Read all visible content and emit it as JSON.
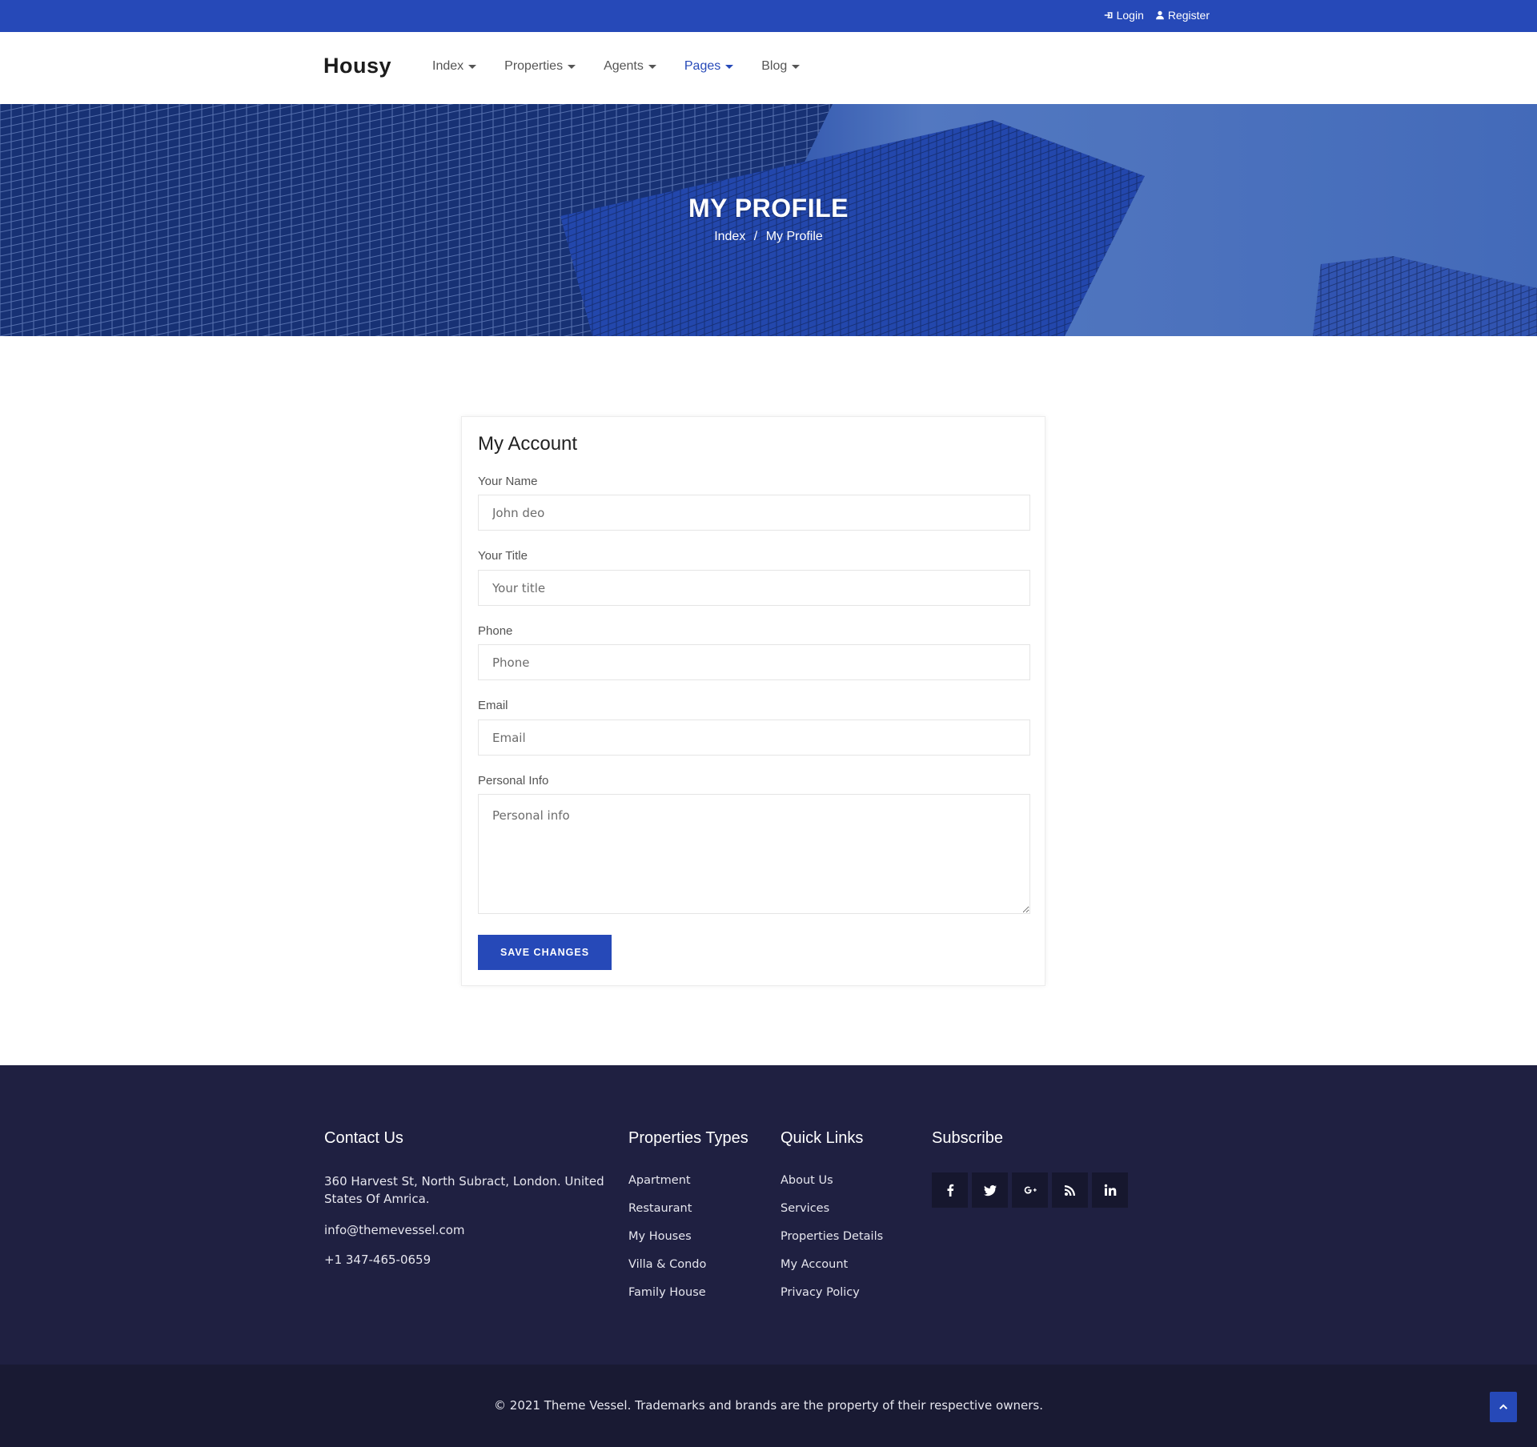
{
  "topbar": {
    "login_label": "Login",
    "register_label": "Register",
    "login_icon": "sign-in-icon",
    "register_icon": "user-icon"
  },
  "brand": {
    "name": "Housy"
  },
  "nav": {
    "items": [
      {
        "label": "Index",
        "active": false
      },
      {
        "label": "Properties",
        "active": false
      },
      {
        "label": "Agents",
        "active": false
      },
      {
        "label": "Pages",
        "active": true
      },
      {
        "label": "Blog",
        "active": false
      }
    ]
  },
  "hero": {
    "title": "MY PROFILE",
    "breadcrumb_home": "Index",
    "breadcrumb_separator": "/",
    "breadcrumb_current": "My Profile"
  },
  "account": {
    "title": "My Account",
    "fields": [
      {
        "label": "Your Name",
        "placeholder": "John deo",
        "value": ""
      },
      {
        "label": "Your Title",
        "placeholder": "Your title",
        "value": ""
      },
      {
        "label": "Phone",
        "placeholder": "Phone",
        "value": ""
      },
      {
        "label": "Email",
        "placeholder": "Email",
        "value": ""
      },
      {
        "label": "Personal Info",
        "placeholder": "Personal info",
        "value": ""
      }
    ],
    "save_label": "SAVE CHANGES"
  },
  "footer": {
    "contact": {
      "heading": "Contact Us",
      "address": "360 Harvest St, North Subract, London. United States Of Amrica.",
      "email": "info@themevessel.com",
      "phone": "+1 347-465-0659"
    },
    "property_types": {
      "heading": "Properties Types",
      "items": [
        "Apartment",
        "Restaurant",
        "My Houses",
        "Villa & Condo",
        "Family House"
      ]
    },
    "quick_links": {
      "heading": "Quick Links",
      "items": [
        "About Us",
        "Services",
        "Properties Details",
        "My Account",
        "Privacy Policy"
      ]
    },
    "subscribe": {
      "heading": "Subscribe",
      "social_icons": [
        "facebook-icon",
        "twitter-icon",
        "google-plus-icon",
        "rss-icon",
        "linkedin-icon"
      ]
    },
    "copyright": "© 2021 Theme Vessel. Trademarks and brands are the property of their respective owners."
  },
  "colors": {
    "primary": "#2649b8",
    "footer_bg": "#1f2041",
    "bottombar_bg": "#191a33",
    "active_nav": "#2649b8"
  }
}
